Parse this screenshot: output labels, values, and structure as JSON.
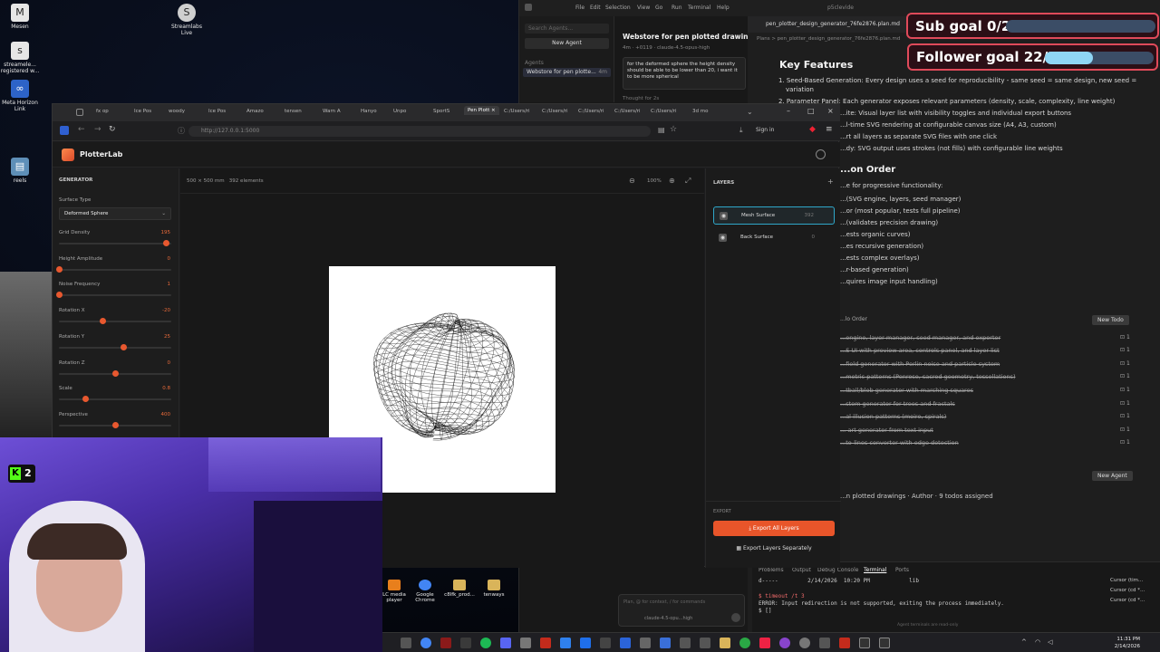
{
  "desktop": {
    "icons": [
      {
        "label": "Mesen",
        "glyph": "M"
      },
      {
        "label": "Streamlabs Live",
        "glyph": "S"
      },
      {
        "label": "streamele... registered w...",
        "glyph": "s"
      },
      {
        "label": "Meta Horizon Link",
        "glyph": "∞"
      },
      {
        "label": "reels",
        "glyph": "▤"
      }
    ],
    "bottom_icons": [
      {
        "label": "LC media player",
        "color": "#e87f1c"
      },
      {
        "label": "Google Chrome",
        "color": "#4285f4"
      },
      {
        "label": "c8lfk_prod...",
        "color": "#d9b45a"
      },
      {
        "label": "tenways",
        "color": "#d9b45a"
      }
    ]
  },
  "editor": {
    "menu": [
      "File",
      "Edit",
      "Selection",
      "View",
      "Go",
      "Run",
      "Terminal",
      "Help"
    ],
    "window_title": "p5clevide",
    "search_placeholder": "Search Agents...",
    "new_agent": "New Agent",
    "agents_heading": "Agents",
    "agent_item": "Webstore for pen plotte...",
    "agent_item_time": "4m",
    "chat_title": "Webstore for pen plotted drawings",
    "chat_meta": "4m · +0119 · claude-4.5-opus-high",
    "chat_message": "for the deformed sphere the height density should be able to be lower than 20, i want it to be more spherical",
    "thought": "Thought for 2s",
    "plan_tab": "pen_plotter_design_generator_76fe2876.plan.md",
    "plans_crumb": "Plans > pen_plotter_design_generator_76fe2876.plan.md",
    "key_features_title": "Key Features",
    "features": [
      "1. Seed-Based Generation: Every design uses a seed for reproducibility - same seed = same design, new seed =",
      "variation",
      "2. Parameter Panel: Each generator exposes relevant parameters (density, scale, complexity, line weight)",
      "...ite: Visual layer list with visibility toggles and individual export buttons",
      "...l-time SVG rendering at configurable canvas size (A4, A3, custom)",
      "...rt all layers as separate SVG files with one click",
      "...dy: SVG output uses strokes (not fills) with configurable line weights"
    ],
    "order_title": "...on Order",
    "order_lines": [
      "...e for progressive functionality:",
      "...(SVG engine, layers, seed manager)",
      "...or (most popular, tests full pipeline)",
      "...(validates precision drawing)",
      "...ests organic curves)",
      "...es recursive generation)",
      "...ests complex overlays)",
      "...r-based generation)",
      "...quires image input handling)"
    ],
    "todos_heading": "...lo Order",
    "new_todo": "New Todo",
    "todos": [
      "...engine, layer manager, seed manager, and exporter",
      "...S UI with preview area, controls panel, and layer list",
      "...field generator with Perlin noise and particle system",
      "...metric patterns (Penrose, sacred geometry, tessellations)",
      "...tball/blob generator with marching squares",
      "...stem generator for trees and fractals",
      "...al illusion patterns (moire, spirals)",
      "...-art generator from text input",
      "...to-lines converter with edge detection"
    ],
    "todo_badge": "1",
    "new_agent_btn": "New Agent",
    "footer_line": "...n plotted drawings · Author · 9 todos assigned",
    "composer_placeholder": "Plan, @ for context, / for commands",
    "composer_model": "claude-4.5-opu...high",
    "terminal": {
      "tabs": [
        "Problems",
        "Output",
        "Debug Console",
        "Terminal",
        "Ports"
      ],
      "line1": "d-----         2/14/2026  10:20 PM            lib",
      "line2": "$ timeout /t 3",
      "line3": "ERROR: Input redirection is not supported, exiting the process immediately.",
      "line4": "$ []",
      "side_items": [
        "Cursor (tim...",
        "Cursor (cd *...",
        "Cursor (cd *..."
      ],
      "footer": "Agent terminals are read-only"
    }
  },
  "goals": {
    "sub": {
      "label": "Sub goal 0/20",
      "fraction": 0.0
    },
    "follower": {
      "label": "Follower goal 22/50",
      "fraction": 0.44
    }
  },
  "browser": {
    "tabs": [
      "fx op",
      "Ice Pos",
      "woody",
      "Ice Pos",
      "Amazo",
      "tensen",
      "Warn A",
      "Hanyo",
      "Unpo",
      "SportS",
      "Pen Plott ×",
      "C:/Users/ri",
      "C:/Users/ri",
      "C:/Users/ri",
      "C:/Users/ri",
      "C:/Users/ri",
      "3d mo"
    ],
    "url": "http://127.0.0.1:5000",
    "sign_in": "Sign in"
  },
  "app": {
    "title": "PlotterLab",
    "generator_heading": "GENERATOR",
    "surface_type_label": "Surface Type",
    "surface_type_value": "Deformed Sphere",
    "params": [
      {
        "label": "Grid Density",
        "value": "195",
        "fraction": 0.95
      },
      {
        "label": "Height Amplitude",
        "value": "0",
        "fraction": 0.0
      },
      {
        "label": "Noise Frequency",
        "value": "1",
        "fraction": 0.0
      },
      {
        "label": "Rotation X",
        "value": "-20",
        "fraction": 0.39
      },
      {
        "label": "Rotation Y",
        "value": "25",
        "fraction": 0.57
      },
      {
        "label": "Rotation Z",
        "value": "0",
        "fraction": 0.5
      },
      {
        "label": "Scale",
        "value": "0.8",
        "fraction": 0.23
      },
      {
        "label": "Perspective",
        "value": "400",
        "fraction": 0.5
      }
    ],
    "canvas_info": "500 × 500 mm   392 elements",
    "zoom": "100%",
    "layers_heading": "LAYERS",
    "layers": [
      {
        "name": "Mesh Surface",
        "count": "392",
        "selected": true
      },
      {
        "name": "Back Surface",
        "count": "0",
        "selected": false
      }
    ],
    "export_heading": "EXPORT",
    "export_all": "Export All Layers",
    "export_separately": "Export Layers Separately"
  },
  "webcam": {
    "badge": "2"
  },
  "taskbar": {
    "time": "11:31 PM",
    "date": "2/14/2026"
  }
}
